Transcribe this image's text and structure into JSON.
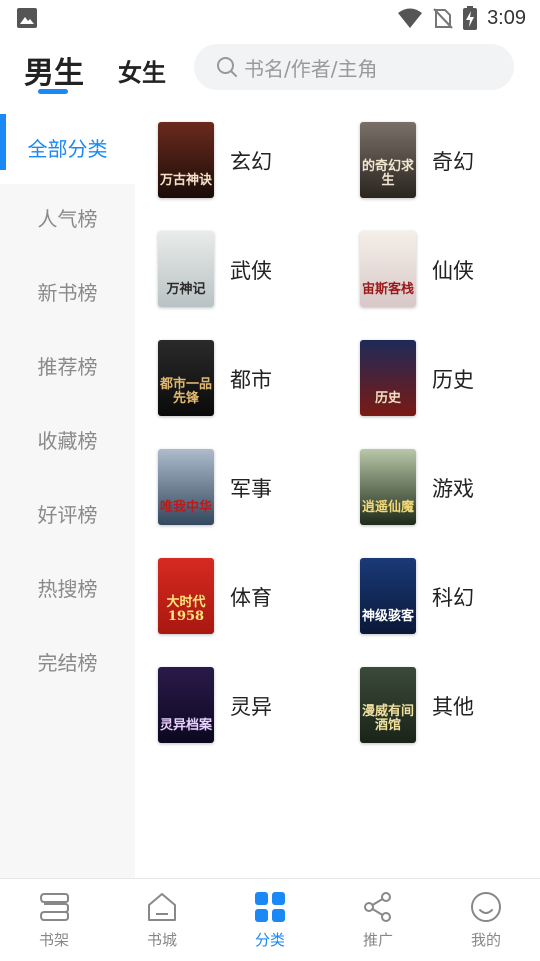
{
  "status_bar": {
    "time": "3:09"
  },
  "header": {
    "tabs": [
      {
        "label": "男生",
        "active": true
      },
      {
        "label": "女生",
        "active": false
      }
    ],
    "search_placeholder": "书名/作者/主角"
  },
  "sidebar": {
    "items": [
      {
        "label": "全部分类",
        "active": true
      },
      {
        "label": "人气榜"
      },
      {
        "label": "新书榜"
      },
      {
        "label": "推荐榜"
      },
      {
        "label": "收藏榜"
      },
      {
        "label": "好评榜"
      },
      {
        "label": "热搜榜"
      },
      {
        "label": "完结榜"
      }
    ]
  },
  "categories": [
    {
      "label": "玄幻",
      "cover_text": "万古神诀",
      "color_top": "#6b2a1e",
      "color_bottom": "#1a0c08",
      "text_color": "#f3e2c7"
    },
    {
      "label": "奇幻",
      "cover_text": "的奇幻求生",
      "color_top": "#7a7068",
      "color_bottom": "#2a2520",
      "text_color": "#f0e6d0"
    },
    {
      "label": "武侠",
      "cover_text": "万神记",
      "color_top": "#e9ecea",
      "color_bottom": "#b9c2c4",
      "text_color": "#2b2b2b"
    },
    {
      "label": "仙侠",
      "cover_text": "宙斯客栈",
      "color_top": "#f5efe8",
      "color_bottom": "#d8c8c8",
      "text_color": "#9a1a1a"
    },
    {
      "label": "都市",
      "cover_text": "都市一品先锋",
      "color_top": "#2a2a2a",
      "color_bottom": "#0a0a0a",
      "text_color": "#e0b870"
    },
    {
      "label": "历史",
      "cover_text": "历史",
      "color_top": "#1e2a58",
      "color_bottom": "#7a1a14",
      "text_color": "#f0e0c0"
    },
    {
      "label": "军事",
      "cover_text": "唯我中华",
      "color_top": "#aebccc",
      "color_bottom": "#33485e",
      "text_color": "#c01818"
    },
    {
      "label": "游戏",
      "cover_text": "逍遥仙魔",
      "color_top": "#b8c8a8",
      "color_bottom": "#1e2a1a",
      "text_color": "#f0d878"
    },
    {
      "label": "体育",
      "cover_text": "大时代1958",
      "color_top": "#d62a20",
      "color_bottom": "#a81810",
      "text_color": "#ffe680"
    },
    {
      "label": "科幻",
      "cover_text": "神级骇客",
      "color_top": "#1a3a78",
      "color_bottom": "#0a1838",
      "text_color": "#ffffff"
    },
    {
      "label": "灵异",
      "cover_text": "灵异档案",
      "color_top": "#2a1a4a",
      "color_bottom": "#0c0820",
      "text_color": "#e8d0ff"
    },
    {
      "label": "其他",
      "cover_text": "漫威有间酒馆",
      "color_top": "#3a4a3a",
      "color_bottom": "#1a2418",
      "text_color": "#f0e0a0"
    }
  ],
  "bottom_nav": [
    {
      "label": "书架",
      "icon": "bookshelf-icon"
    },
    {
      "label": "书城",
      "icon": "bookstore-icon"
    },
    {
      "label": "分类",
      "icon": "category-grid-icon",
      "active": true
    },
    {
      "label": "推广",
      "icon": "share-icon"
    },
    {
      "label": "我的",
      "icon": "profile-icon"
    }
  ],
  "colors": {
    "accent": "#1a88f5",
    "sidebar_bg": "#f7f7f7",
    "text_muted": "#8a8a8a"
  }
}
